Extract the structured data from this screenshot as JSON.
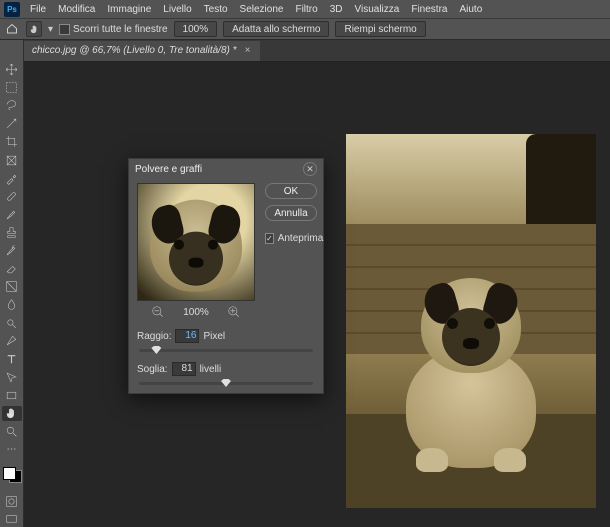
{
  "app": {
    "badge": "Ps"
  },
  "menu": {
    "items": [
      "File",
      "Modifica",
      "Immagine",
      "Livello",
      "Testo",
      "Selezione",
      "Filtro",
      "3D",
      "Visualizza",
      "Finestra",
      "Aiuto"
    ]
  },
  "options": {
    "scroll_all_windows": "Scorri tutte le finestre",
    "zoom_value": "100%",
    "fit_screen": "Adatta allo schermo",
    "fill_screen": "Riempi schermo"
  },
  "tab": {
    "label": "chicco.jpg @ 66,7% (Livello 0, Tre tonalità/8) *"
  },
  "dialog": {
    "title": "Polvere e graffi",
    "ok": "OK",
    "cancel": "Annulla",
    "preview_label": "Anteprima",
    "preview_checked": true,
    "zoom_value": "100%",
    "radius_label": "Raggio:",
    "radius_value": "16",
    "radius_unit": "Pixel",
    "threshold_label": "Soglia:",
    "threshold_value": "81",
    "threshold_unit": "livelli",
    "radius_slider_percent": 10,
    "threshold_slider_percent": 50
  }
}
